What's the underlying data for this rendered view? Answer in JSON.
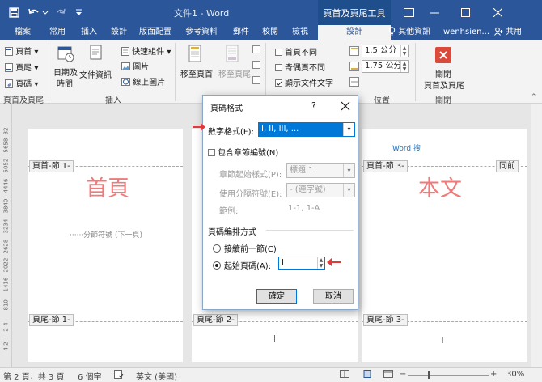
{
  "titlebar": {
    "doc_title": "文件1 - Word",
    "context_title": "頁首及頁尾工具",
    "save_icon": "save-icon",
    "undo_icon": "undo-icon",
    "redo_icon": "redo-icon"
  },
  "tabs": [
    "檔案",
    "常用",
    "插入",
    "設計",
    "版面配置",
    "參考資料",
    "郵件",
    "校閱",
    "檢視",
    "設計"
  ],
  "tell_me": "其他資訊",
  "user": "wenhsien...",
  "share": "共用",
  "ribbon": {
    "header_btn": "頁首",
    "footer_btn": "頁尾",
    "pagenum_btn": "頁碼",
    "group1_label": "頁首及頁尾",
    "datetime_btn": [
      "日期及",
      "時間"
    ],
    "docinfo_btn": "文件資訊",
    "quickparts_btn": "快速組件",
    "pictures_btn": "圖片",
    "onlinepics_btn": "線上圖片",
    "group2_label": "插入",
    "goto_header": "移至頁首",
    "goto_footer": "移至頁尾",
    "diff_first": "首頁不同",
    "diff_oddeven": "奇偶頁不同",
    "show_text": "顯示文件文字",
    "header_pos": "1.5 公分",
    "footer_pos": "1.75 公分",
    "group4_label": "位置",
    "close_btn": [
      "關閉",
      "頁首及頁尾"
    ],
    "group5_label": "關閉"
  },
  "vruler": [
    "82",
    "5658",
    "5052",
    "4446",
    "3840",
    "3234",
    "2628",
    "2022",
    "1416",
    "810",
    "2 4",
    "4 2"
  ],
  "document": {
    "page1_header_tag": "頁首-節 1-",
    "page1_big": "首頁",
    "page1_break": "分節符號 (下一頁)",
    "page1_footer_tag": "頁尾-節 1-",
    "page2_footer_tag": "頁尾-節 2-",
    "page3_header_tag": "頁首-節 3-",
    "page3_same": "同前",
    "page3_title": "Word 搜",
    "page3_big": "本文",
    "page3_footer_tag": "頁尾-節 3-"
  },
  "dialog": {
    "title": "頁碼格式",
    "help": "?",
    "number_format_label": "數字格式(F):",
    "number_format_value": "I, II, III, ...",
    "include_chapter": "包含章節編號(N)",
    "chapter_style_label": "章節起始樣式(P):",
    "chapter_style_value": "標題 1",
    "separator_label": "使用分隔符號(E):",
    "separator_value": "-  (連字號)",
    "example_label": "範例:",
    "example_value": "1-1, 1-A",
    "numbering_section": "頁碼編排方式",
    "continue_option": "接續前一節(C)",
    "start_at_option": "起始頁碼(A):",
    "start_at_value": "I",
    "ok_label": "確定",
    "cancel_label": "取消"
  },
  "status": {
    "page": "第 2 頁，共 3 頁",
    "words": "6 個字",
    "language": "英文 (美國)",
    "zoom": "30%"
  }
}
